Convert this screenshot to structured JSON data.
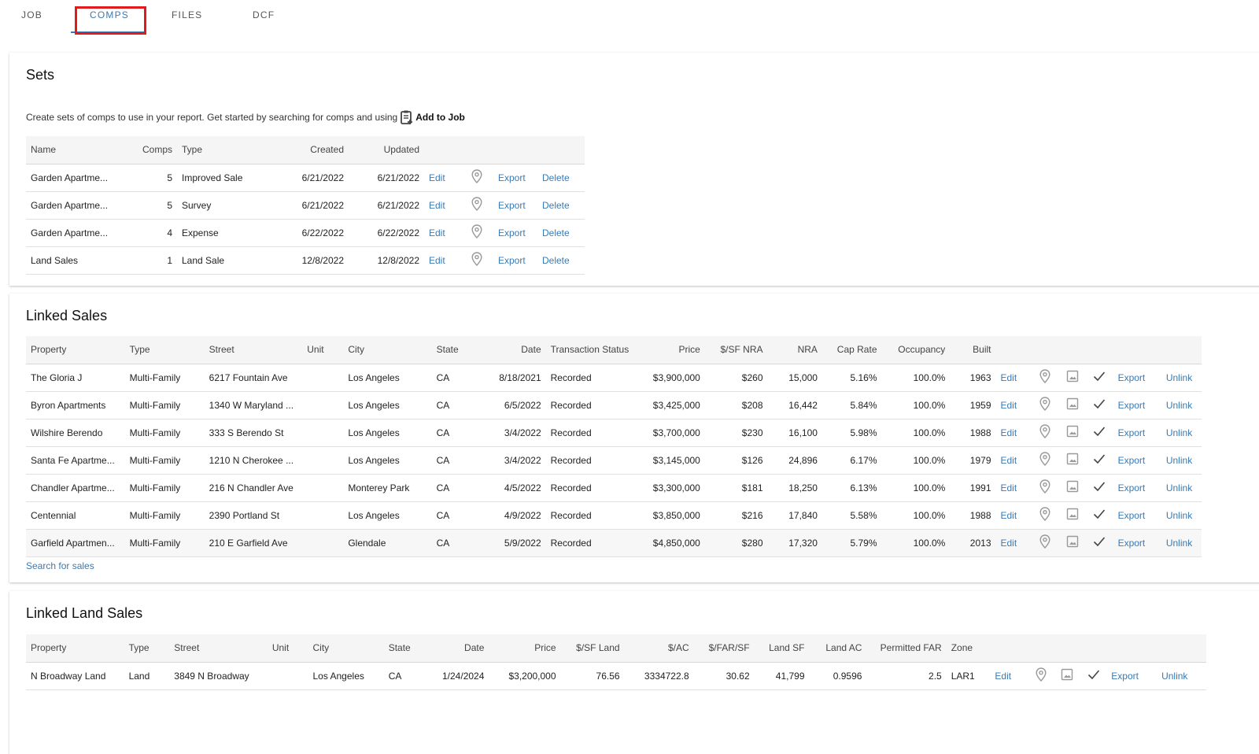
{
  "tabs": [
    {
      "label": "JOB"
    },
    {
      "label": "COMPS"
    },
    {
      "label": "FILES"
    },
    {
      "label": "DCF"
    }
  ],
  "sets": {
    "title": "Sets",
    "intro_text": "Create sets of comps to use in your report. Get started by searching for comps and using",
    "intro_action": "Add to Job",
    "columns": {
      "name": "Name",
      "comps": "Comps",
      "type": "Type",
      "created": "Created",
      "updated": "Updated"
    },
    "rows": [
      {
        "name": "Garden Apartme...",
        "comps": "5",
        "type": "Improved Sale",
        "created": "6/21/2022",
        "updated": "6/21/2022"
      },
      {
        "name": "Garden Apartme...",
        "comps": "5",
        "type": "Survey",
        "created": "6/21/2022",
        "updated": "6/21/2022"
      },
      {
        "name": "Garden Apartme...",
        "comps": "4",
        "type": "Expense",
        "created": "6/22/2022",
        "updated": "6/22/2022"
      },
      {
        "name": "Land Sales",
        "comps": "1",
        "type": "Land Sale",
        "created": "12/8/2022",
        "updated": "12/8/2022"
      }
    ],
    "actions": {
      "edit": "Edit",
      "export": "Export",
      "delete": "Delete"
    }
  },
  "linked_sales": {
    "title": "Linked Sales",
    "columns": {
      "property": "Property",
      "type": "Type",
      "street": "Street",
      "unit": "Unit",
      "city": "City",
      "state": "State",
      "date": "Date",
      "status": "Transaction Status",
      "price": "Price",
      "psf": "$/SF NRA",
      "nra": "NRA",
      "cap": "Cap Rate",
      "occ": "Occupancy",
      "built": "Built"
    },
    "rows": [
      {
        "property": "The Gloria J",
        "type": "Multi-Family",
        "street": "6217 Fountain Ave",
        "unit": "",
        "city": "Los Angeles",
        "state": "CA",
        "date": "8/18/2021",
        "status": "Recorded",
        "price": "$3,900,000",
        "psf": "$260",
        "nra": "15,000",
        "cap": "5.16%",
        "occ": "100.0%",
        "built": "1963"
      },
      {
        "property": "Byron Apartments",
        "type": "Multi-Family",
        "street": "1340 W Maryland ...",
        "unit": "",
        "city": "Los Angeles",
        "state": "CA",
        "date": "6/5/2022",
        "status": "Recorded",
        "price": "$3,425,000",
        "psf": "$208",
        "nra": "16,442",
        "cap": "5.84%",
        "occ": "100.0%",
        "built": "1959"
      },
      {
        "property": "Wilshire Berendo",
        "type": "Multi-Family",
        "street": "333 S Berendo St",
        "unit": "",
        "city": "Los Angeles",
        "state": "CA",
        "date": "3/4/2022",
        "status": "Recorded",
        "price": "$3,700,000",
        "psf": "$230",
        "nra": "16,100",
        "cap": "5.98%",
        "occ": "100.0%",
        "built": "1988"
      },
      {
        "property": "Santa Fe Apartme...",
        "type": "Multi-Family",
        "street": "1210 N Cherokee ...",
        "unit": "",
        "city": "Los Angeles",
        "state": "CA",
        "date": "3/4/2022",
        "status": "Recorded",
        "price": "$3,145,000",
        "psf": "$126",
        "nra": "24,896",
        "cap": "6.17%",
        "occ": "100.0%",
        "built": "1979"
      },
      {
        "property": "Chandler Apartme...",
        "type": "Multi-Family",
        "street": "216 N Chandler Ave",
        "unit": "",
        "city": "Monterey Park",
        "state": "CA",
        "date": "4/5/2022",
        "status": "Recorded",
        "price": "$3,300,000",
        "psf": "$181",
        "nra": "18,250",
        "cap": "6.13%",
        "occ": "100.0%",
        "built": "1991"
      },
      {
        "property": "Centennial",
        "type": "Multi-Family",
        "street": "2390 Portland St",
        "unit": "",
        "city": "Los Angeles",
        "state": "CA",
        "date": "4/9/2022",
        "status": "Recorded",
        "price": "$3,850,000",
        "psf": "$216",
        "nra": "17,840",
        "cap": "5.58%",
        "occ": "100.0%",
        "built": "1988"
      },
      {
        "property": "Garfield Apartmen...",
        "type": "Multi-Family",
        "street": "210 E Garfield Ave",
        "unit": "",
        "city": "Glendale",
        "state": "CA",
        "date": "5/9/2022",
        "status": "Recorded",
        "price": "$4,850,000",
        "psf": "$280",
        "nra": "17,320",
        "cap": "5.79%",
        "occ": "100.0%",
        "built": "2013"
      }
    ],
    "actions": {
      "edit": "Edit",
      "export": "Export",
      "unlink": "Unlink"
    },
    "search_link": "Search for sales"
  },
  "linked_land_sales": {
    "title": "Linked Land Sales",
    "columns": {
      "property": "Property",
      "type": "Type",
      "street": "Street",
      "unit": "Unit",
      "city": "City",
      "state": "State",
      "date": "Date",
      "price": "Price",
      "psf_land": "$/SF Land",
      "pac": "$/AC",
      "pfar": "$/FAR/SF",
      "land_sf": "Land SF",
      "land_ac": "Land AC",
      "far": "Permitted FAR",
      "zone": "Zone"
    },
    "rows": [
      {
        "property": "N Broadway Land",
        "type": "Land",
        "street": "3849 N Broadway",
        "unit": "",
        "city": "Los Angeles",
        "state": "CA",
        "date": "1/24/2024",
        "price": "$3,200,000",
        "psf_land": "76.56",
        "pac": "3334722.8",
        "pfar": "30.62",
        "land_sf": "41,799",
        "land_ac": "0.9596",
        "far": "2.5",
        "zone": "LAR1"
      }
    ],
    "actions": {
      "edit": "Edit",
      "export": "Export",
      "unlink": "Unlink"
    }
  },
  "colors": {
    "accent": "#3a7ab3",
    "highlight": "#e01b1b",
    "header_bg": "#f5f5f5"
  },
  "icons": {
    "map_pin": "map-pin-icon",
    "image": "image-icon",
    "check": "check-icon",
    "clipboard": "clipboard-add-icon"
  }
}
